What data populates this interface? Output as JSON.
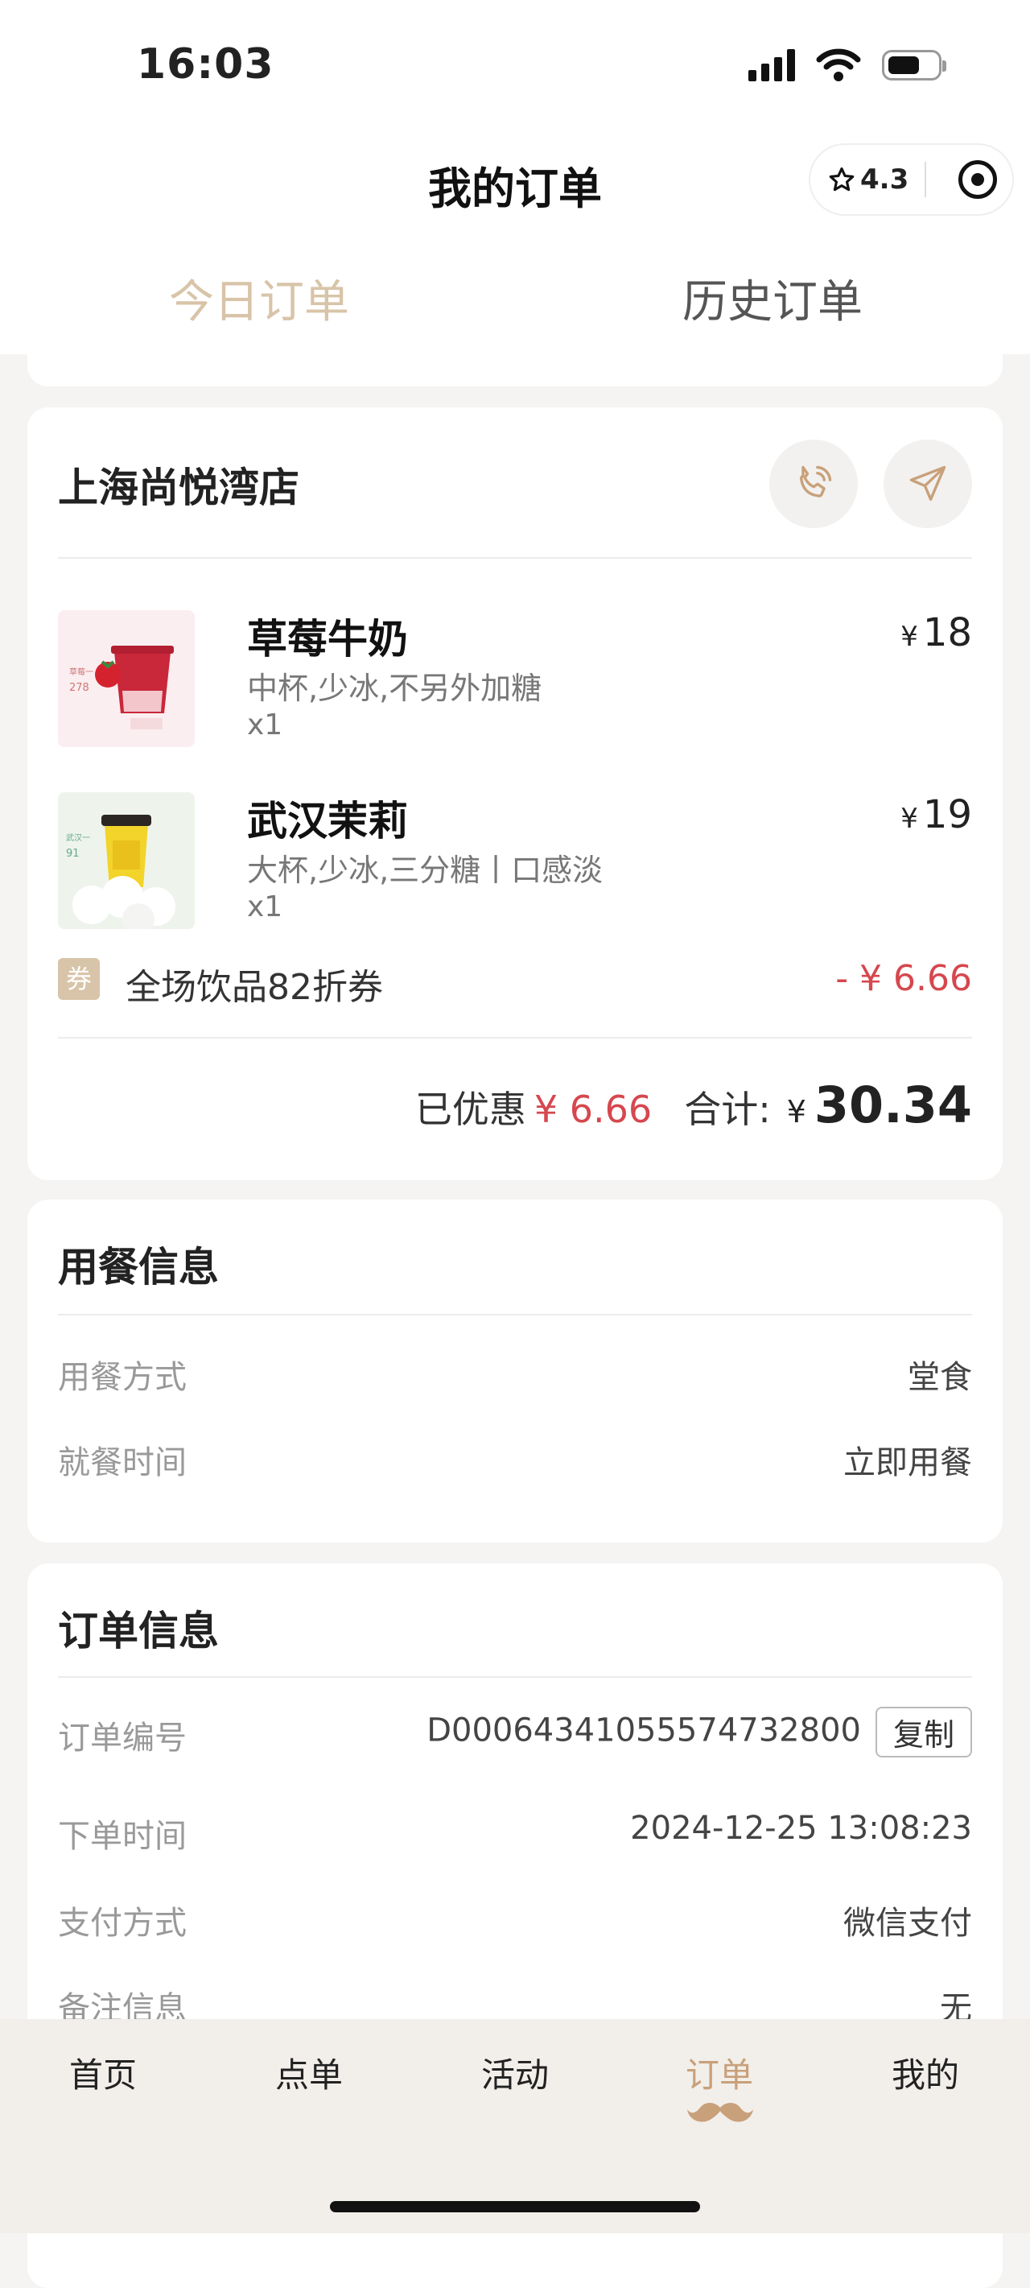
{
  "status_bar": {
    "time": "16:03"
  },
  "nav": {
    "title": "我的订单",
    "rating": "4.3"
  },
  "tabs": [
    {
      "label": "今日订单"
    },
    {
      "label": "历史订单"
    }
  ],
  "store": {
    "name": "上海尚悦湾店"
  },
  "items": [
    {
      "name": "草莓牛奶",
      "spec": "中杯,少冰,不另外加糖",
      "qty": "x1",
      "currency": "¥",
      "price": "18"
    },
    {
      "name": "武汉茉莉",
      "spec": "大杯,少冰,三分糖丨口感淡",
      "qty": "x1",
      "currency": "¥",
      "price": "19"
    }
  ],
  "coupon": {
    "badge": "券",
    "text": "全场饮品82折券",
    "amount": "- ¥ 6.66"
  },
  "totals": {
    "discount_label": "已优惠",
    "discount": "¥ 6.66",
    "total_label": "合计:",
    "currency": "¥",
    "total": "30.34"
  },
  "meal_info": {
    "title": "用餐信息",
    "rows": [
      {
        "key": "用餐方式",
        "value": "堂食"
      },
      {
        "key": "就餐时间",
        "value": "立即用餐"
      }
    ]
  },
  "order_info": {
    "title": "订单信息",
    "order_no_label": "订单编号",
    "order_no": "D000643410555747328​00",
    "copy_label": "复制",
    "rows": [
      {
        "key": "下单时间",
        "value": "2024-12-25 13:08:23"
      },
      {
        "key": "支付方式",
        "value": "微信支付"
      },
      {
        "key": "备注信息",
        "value": "无"
      }
    ]
  },
  "tabbar": [
    {
      "label": "首页"
    },
    {
      "label": "点单"
    },
    {
      "label": "活动"
    },
    {
      "label": "订单"
    },
    {
      "label": "我的"
    }
  ],
  "colors": {
    "accent": "#d8c4a8",
    "discount_red": "#d6474e",
    "tab_active": "#c8a07a"
  }
}
